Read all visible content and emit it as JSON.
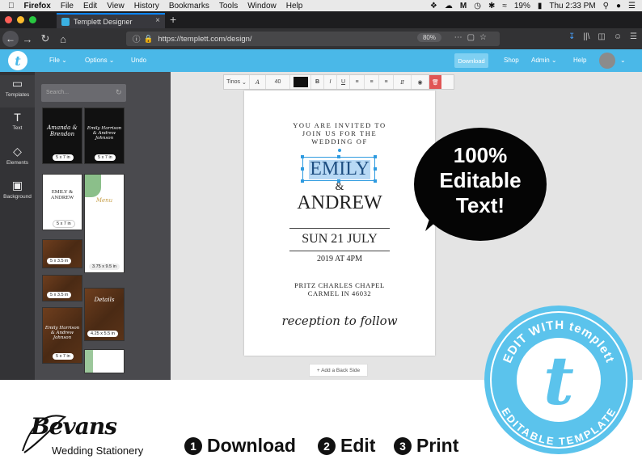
{
  "menubar": {
    "items": [
      "Firefox",
      "File",
      "Edit",
      "View",
      "History",
      "Bookmarks",
      "Tools",
      "Window",
      "Help"
    ],
    "battery": "19%",
    "clock": "Thu 2:33 PM"
  },
  "browser": {
    "tab_title": "Templett Designer",
    "url": "https://templett.com/design/",
    "zoom": "80%"
  },
  "app": {
    "menu": [
      "File",
      "Options",
      "Undo"
    ],
    "right_menu": [
      "Download",
      "Shop",
      "Admin",
      "Help"
    ]
  },
  "rail": [
    "Templates",
    "Text",
    "Elements",
    "Background"
  ],
  "panel": {
    "search_placeholder": "Search...",
    "thumbs": [
      {
        "label": "5 x 7 in",
        "title": "Amanda & Brendon"
      },
      {
        "label": "5 x 7 in",
        "title": "Emily Harrison & Andrew Johnson"
      },
      {
        "label": "5 x 7 in",
        "title": "EMILY & ANDREW"
      },
      {
        "label": "3.75 x 9.5 in",
        "title": "Menu"
      },
      {
        "label": "5 x 3.5 in",
        "title": ""
      },
      {
        "label": "5 x 3.5 in",
        "title": ""
      },
      {
        "label": "4.25 x 5.5 in",
        "title": "Details"
      },
      {
        "label": "5 x 7 in",
        "title": "Emily Harrison & Andrew Johnson"
      }
    ]
  },
  "toolbar": {
    "font": "Tinos",
    "size": "40",
    "bold": "B",
    "italic": "I",
    "underline": "U"
  },
  "invite": {
    "line1": "YOU ARE INVITED TO",
    "line2": "JOIN US FOR THE",
    "line3": "WEDDING OF",
    "name1": "EMILY",
    "amp": "&",
    "name2": "ANDREW",
    "date": "SUN   21   JULY",
    "time": "2019   AT   4PM",
    "venue1": "PRITZ  CHARLES  CHAPEL",
    "venue2": "CARMEL  IN  46032",
    "closing": "reception to follow"
  },
  "add_back": "+ Add a Back Side",
  "bubble": [
    "100%",
    "Editable",
    "Text!"
  ],
  "badge": {
    "top": "EDIT WITH templett",
    "bottom": "EDITABLE TEMPLATE",
    "letter": "t"
  },
  "brand": {
    "name": "Bevans",
    "sub": "Wedding Stationery"
  },
  "steps": [
    {
      "n": "1",
      "label": "Download"
    },
    {
      "n": "2",
      "label": "Edit"
    },
    {
      "n": "3",
      "label": "Print"
    }
  ],
  "colors": {
    "accent": "#4ab8e8",
    "highlight": "#b8d9f5"
  }
}
